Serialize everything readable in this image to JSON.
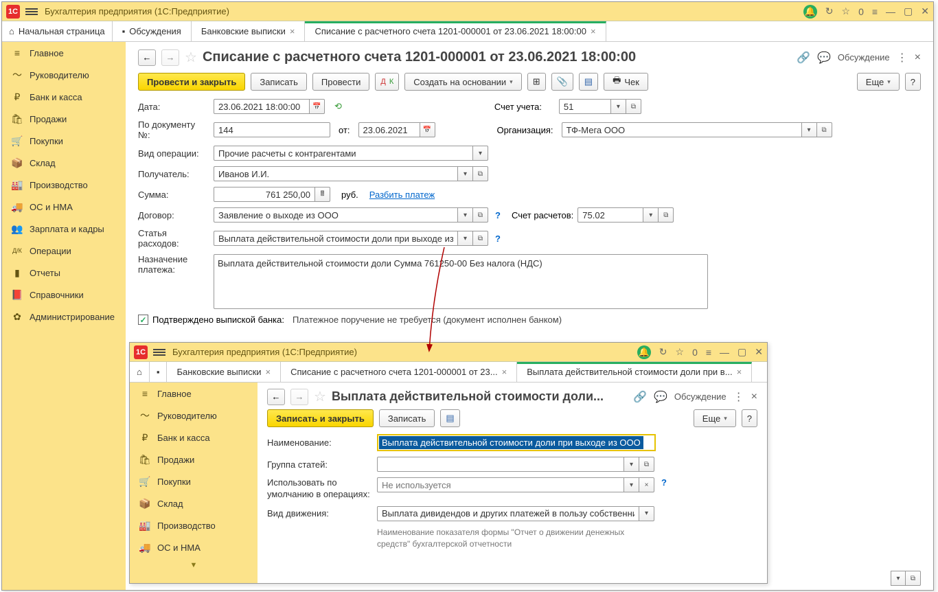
{
  "app": {
    "title": "Бухгалтерия предприятия  (1С:Предприятие)"
  },
  "tabs": {
    "home": "Начальная страница",
    "discuss": "Обсуждения",
    "bank": "Банковские выписки",
    "doc": "Списание с расчетного счета 1201-000001 от 23.06.2021 18:00:00"
  },
  "sidebar": {
    "items": [
      {
        "label": "Главное",
        "icon": "≡"
      },
      {
        "label": "Руководителю",
        "icon": "〜"
      },
      {
        "label": "Банк и касса",
        "icon": "₽"
      },
      {
        "label": "Продажи",
        "icon": "🛍"
      },
      {
        "label": "Покупки",
        "icon": "🛒"
      },
      {
        "label": "Склад",
        "icon": "📦"
      },
      {
        "label": "Производство",
        "icon": "🏭"
      },
      {
        "label": "ОС и НМА",
        "icon": "🚚"
      },
      {
        "label": "Зарплата и кадры",
        "icon": "👥"
      },
      {
        "label": "Операции",
        "icon": "Дт/Кт"
      },
      {
        "label": "Отчеты",
        "icon": "▮"
      },
      {
        "label": "Справочники",
        "icon": "📕"
      },
      {
        "label": "Администрирование",
        "icon": "✿"
      }
    ]
  },
  "doc": {
    "title": "Списание с расчетного счета 1201-000001 от 23.06.2021 18:00:00",
    "discussion": "Обсуждение",
    "toolbar": {
      "execute_close": "Провести и закрыть",
      "save": "Записать",
      "execute": "Провести",
      "create_based": "Создать на основании",
      "check": "Чек",
      "more": "Еще"
    },
    "labels": {
      "date": "Дата:",
      "doc_no": "По документу №:",
      "doc_from": "от:",
      "optype": "Вид операции:",
      "recipient": "Получатель:",
      "amount": "Сумма:",
      "rub": "руб.",
      "split": "Разбить платеж",
      "contract": "Договор:",
      "expense_item": "Статья расходов:",
      "purpose": "Назначение платежа:",
      "account": "Счет учета:",
      "org": "Организация:",
      "settle_acct": "Счет расчетов:",
      "confirmed": "Подтверждено выпиской банка:",
      "confirmed_text": "Платежное поручение не требуется (документ исполнен банком)"
    },
    "values": {
      "date": "23.06.2021 18:00:00",
      "doc_no": "144",
      "doc_date": "23.06.2021",
      "optype": "Прочие расчеты с контрагентами",
      "recipient": "Иванов И.И.",
      "amount": "761 250,00",
      "contract": "Заявление о выходе из ООО",
      "expense_item": "Выплата действительной стоимости доли при выходе из ОС",
      "purpose": "Выплата действительной стоимости доли Сумма 761250-00 Без налога (НДС)",
      "account": "51",
      "org": "ТФ-Мега ООО",
      "settle_acct": "75.02"
    }
  },
  "w2": {
    "tabs": {
      "bank": "Банковские выписки",
      "doc": "Списание с расчетного счета 1201-000001 от 23...",
      "article": "Выплата действительной стоимости доли при в..."
    },
    "title": "Выплата действительной стоимости доли...",
    "discussion": "Обсуждение",
    "toolbar": {
      "save_close": "Записать и закрыть",
      "save": "Записать",
      "more": "Еще"
    },
    "labels": {
      "name": "Наименование:",
      "group": "Группа статей:",
      "default_ops": "Использовать по умолчанию в операциях:",
      "default_ops_ph": "Не используется",
      "movement": "Вид движения:"
    },
    "values": {
      "name": "Выплата действительной стоимости доли при выходе из ООО",
      "movement": "Выплата дивидендов и других платежей в пользу собственников"
    },
    "hint": "Наименование показателя формы \"Отчет о движении денежных средств\" бухгалтерской отчетности"
  }
}
